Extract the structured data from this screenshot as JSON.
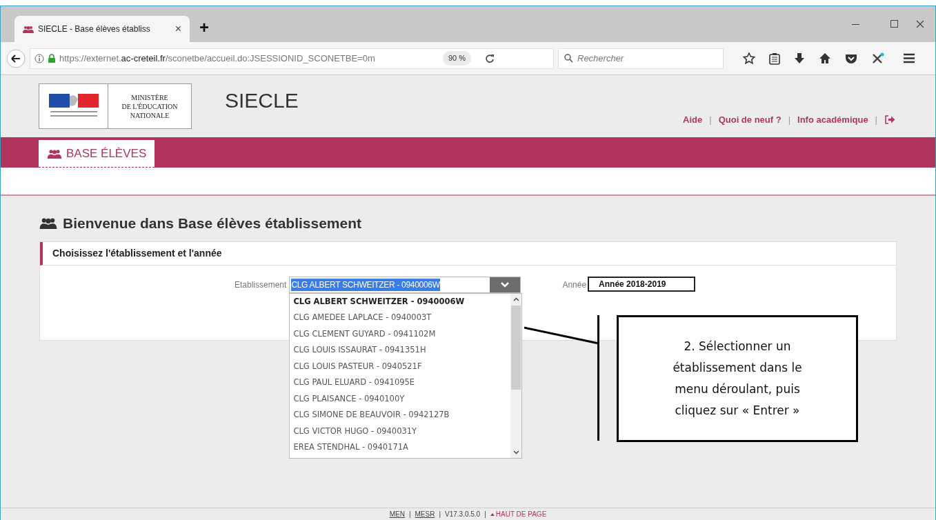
{
  "browser": {
    "tab_title": "SIECLE - Base élèves établiss",
    "tab_close": "×",
    "new_tab": "+",
    "url": "https://externet.**ac-creteil.fr**/sconetbe/accueil.do:JSESSIONID_SCONETBE=0m",
    "zoom": "90 %",
    "search_placeholder": "Rechercher"
  },
  "header": {
    "ministry_lines": [
      "MINISTÈRE",
      "DE L'ÉDUCATION",
      "NATIONALE"
    ],
    "app_name": "SIECLE",
    "links": [
      "Aide",
      "Quoi de neuf ?",
      "Info académique"
    ],
    "separator": "|"
  },
  "nav_tabs": [
    {
      "label": "BASE ÉLÈVES",
      "selected": true
    }
  ],
  "page_title": "Bienvenue dans Base élèves établissement",
  "card": {
    "title": "Choisissez l'établissement et l'année",
    "establishment": {
      "label": "Etablissement",
      "value": "CLG ALBERT SCHWEITZER - 0940006W",
      "expanded": true,
      "options": [
        {
          "label": "CLG ALBERT SCHWEITZER - 0940006W",
          "selected": true
        },
        {
          "label": "CLG AMEDEE LAPLACE - 0940003T",
          "selected": false
        },
        {
          "label": "CLG CLEMENT GUYARD - 0941102M",
          "selected": false
        },
        {
          "label": "CLG LOUIS ISSAURAT - 0941351H",
          "selected": false
        },
        {
          "label": "CLG LOUIS PASTEUR - 0940521F",
          "selected": false
        },
        {
          "label": "CLG PAUL ELUARD - 0941095E",
          "selected": false
        },
        {
          "label": "CLG PLAISANCE - 0940100Y",
          "selected": false
        },
        {
          "label": "CLG SIMONE DE BEAUVOIR - 0942127B",
          "selected": false
        },
        {
          "label": "CLG VICTOR HUGO - 0940031Y",
          "selected": false
        },
        {
          "label": "EREA STENDHAL - 0940171A",
          "selected": false
        }
      ]
    },
    "year": {
      "label": "Année",
      "value": "Année 2018-2019"
    }
  },
  "callout": "2. Sélectionner un établissement dans le menu déroulant, puis cliquez sur « Entrer »",
  "footer": {
    "links": [
      "MEN",
      "MESR"
    ],
    "version": "V17.3.0.5.0",
    "top_link": "HAUT DE PAGE",
    "separator": "|"
  }
}
